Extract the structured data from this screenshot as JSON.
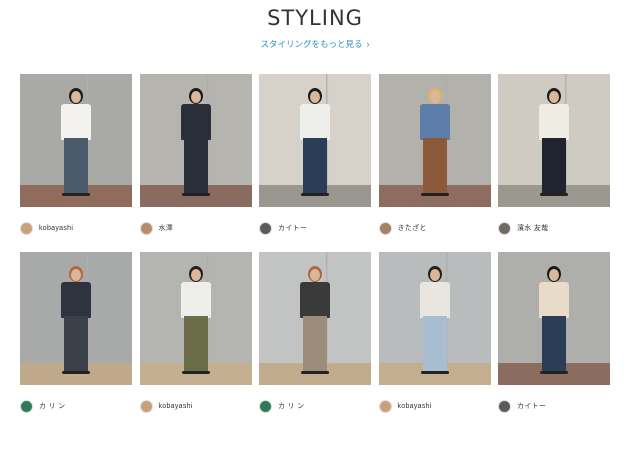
{
  "header": {
    "title": "STYLING",
    "more_link": "スタイリングをもっと見る"
  },
  "styles": [
    {
      "user": "kobayashi",
      "avatar_color": "#c9a27a",
      "bg": "#a9a9a6",
      "ground": "#8f6c5c",
      "shirt": "#f4f2ee",
      "pants": "#4c5a6e",
      "hair": "#1d1b19"
    },
    {
      "user": "水澤",
      "avatar_color": "#b88b6a",
      "bg": "#b6b4ae",
      "ground": "#8a6b5f",
      "shirt": "#2b2f3a",
      "pants": "#2b2f3a",
      "hair": "#1b1a1a"
    },
    {
      "user": "カイトー",
      "avatar_color": "#5b5b5b",
      "bg": "#d6d2ca",
      "ground": "#9a9790",
      "shirt": "#eeeeea",
      "pants": "#2c3d57",
      "hair": "#1d1b19"
    },
    {
      "user": "きたざと",
      "avatar_color": "#a88064",
      "bg": "#b3b1ab",
      "ground": "#8e6d60",
      "shirt": "#5d7ea8",
      "pants": "#8a5a3a",
      "hair": "#e1b167"
    },
    {
      "user": "濱水 友哉",
      "avatar_color": "#6f6a62",
      "bg": "#cfcbc3",
      "ground": "#9b9890",
      "shirt": "#efece4",
      "pants": "#1f2430",
      "hair": "#1d1b19"
    },
    {
      "user": "カ リ ン",
      "avatar_color": "#2f7a57",
      "bg": "#a8aaa9",
      "ground": "#bfa98a",
      "shirt": "#2d3440",
      "pants": "#3a3f48",
      "hair": "#b06a3a"
    },
    {
      "user": "kobayashi",
      "avatar_color": "#c9a27a",
      "bg": "#b4b4b0",
      "ground": "#c4af90",
      "shirt": "#eeeeea",
      "pants": "#6b6c48",
      "hair": "#2a1f18"
    },
    {
      "user": "カ リ ン",
      "avatar_color": "#2f7a57",
      "bg": "#c2c4c4",
      "ground": "#c0ab8c",
      "shirt": "#3a3a3a",
      "pants": "#9b8d79",
      "hair": "#b06a3a"
    },
    {
      "user": "kobayashi",
      "avatar_color": "#c9a27a",
      "bg": "#b9bcbd",
      "ground": "#c3ae8f",
      "shirt": "#e9e6df",
      "pants": "#a8bdd0",
      "hair": "#2a1f18"
    },
    {
      "user": "カイトー",
      "avatar_color": "#5b5b5b",
      "bg": "#aeaeab",
      "ground": "#8b6c5e",
      "shirt": "#e8dcc8",
      "pants": "#2c3d57",
      "hair": "#1d1b19"
    }
  ]
}
